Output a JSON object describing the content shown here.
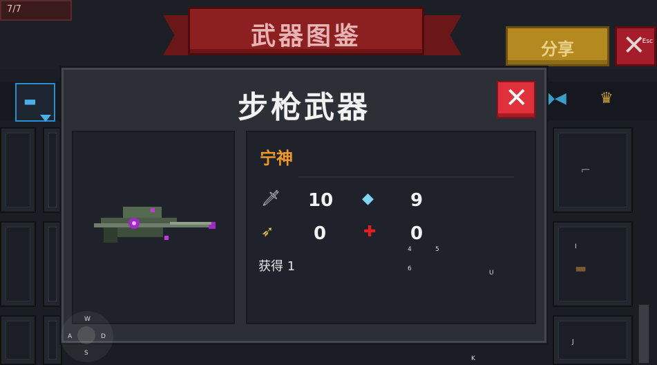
{
  "top": {
    "hp_text": "7/7",
    "banner_title": "武器图鉴",
    "share_label": "分享",
    "close_x": "✕",
    "esc_label": "Esc"
  },
  "tabs": {
    "active_icon": "rifle-icon",
    "items": [
      "rifle-icon",
      "fish-icon",
      "crown-icon"
    ]
  },
  "modal": {
    "title": "步枪武器",
    "close_x": "✕",
    "weapon_name": "宁神",
    "stats": {
      "damage": "10",
      "energy": "9",
      "crit": "0",
      "accuracy": "0"
    },
    "obtain_label": "获得 1"
  },
  "key_hints": {
    "k4": "4",
    "k5": "5",
    "k6": "6",
    "ku": "U",
    "ki": "I",
    "kj": "J",
    "kk": "K",
    "kw": "W",
    "ka": "A",
    "ks": "S",
    "kd": "D"
  },
  "colors": {
    "banner": "#8c1f1f",
    "share": "#b48a20",
    "close": "#e0303a",
    "weapon_name": "#f09a25",
    "tab_active": "#2a8fd0"
  }
}
